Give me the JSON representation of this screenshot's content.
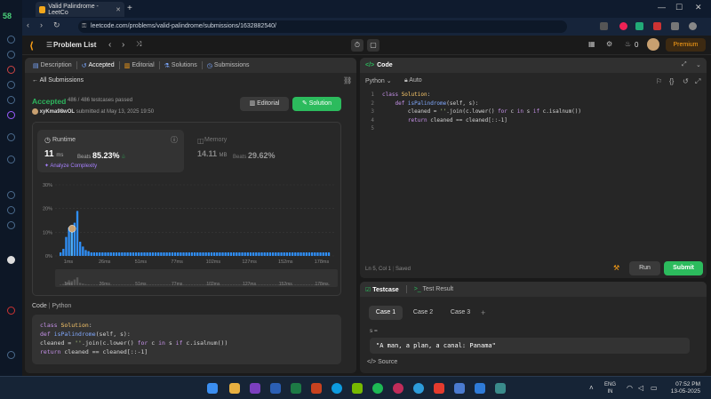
{
  "browser": {
    "tab_title": "Valid Palindrome - LeetCo",
    "url": "leetcode.com/problems/valid-palindrome/submissions/1632882540/",
    "sidebar_number": "58"
  },
  "header": {
    "problem_list": "Problem List",
    "streak": "0",
    "premium": "Premium"
  },
  "left": {
    "tabs": [
      "Description",
      "Accepted",
      "Editorial",
      "Solutions",
      "Submissions"
    ],
    "all_submissions": "All Submissions",
    "status": "Accepted",
    "testcases": "486 / 486 testcases passed",
    "user": "xyKma98wOL",
    "submitted_at": "submitted at May 13, 2025 19:50",
    "editorial_btn": "Editorial",
    "solution_btn": "Solution",
    "runtime": {
      "label": "Runtime",
      "value": "11",
      "unit": "ms",
      "beats_label": "Beats",
      "beats": "85.23%",
      "analyze": "Analyze Complexity"
    },
    "memory": {
      "label": "Memory",
      "value": "14.11",
      "unit": "MB",
      "beats_label": "Beats",
      "beats": "29.62%"
    },
    "code_label": "Code",
    "code_lang": "Python",
    "code_lines": [
      "class Solution:",
      "    def isPalindrome(self, s):",
      "        cleaned = ''.join(c.lower() for c in s if c.isalnum())",
      "        return cleaned == cleaned[::-1]"
    ]
  },
  "chart_data": {
    "type": "bar",
    "y_ticks": [
      "30%",
      "20%",
      "10%",
      "0%"
    ],
    "ylim": [
      0,
      30
    ],
    "x_ticks": [
      "1ms",
      "26ms",
      "51ms",
      "77ms",
      "102ms",
      "127ms",
      "152ms",
      "178ms"
    ],
    "values": [
      1.5,
      3,
      8,
      12,
      10,
      14,
      19,
      6,
      4,
      2.5,
      2,
      1.5,
      1.5,
      1.5,
      1.5,
      1.5,
      1.5,
      1.5,
      1.5,
      1.5,
      1.5,
      1.5,
      1.5,
      1.5,
      1.5,
      1.5,
      1.5,
      1.5,
      1.5,
      1.5,
      1.5,
      1.5,
      1.5,
      1.5,
      1.5,
      1.5,
      1.5,
      1.5,
      1.5,
      1.5,
      1.5,
      1.5,
      1.5,
      1.5,
      1.5,
      1.5,
      1.5,
      1.5,
      1.5,
      1.5,
      1.5,
      1.5,
      1.5,
      1.5,
      1.5,
      1.5,
      1.5,
      1.5,
      1.5,
      1.5,
      1.5,
      1.5,
      1.5,
      1.5,
      1.5,
      1.5,
      1.5,
      1.5,
      1.5,
      1.5,
      1.5,
      1.5,
      1.5,
      1.5,
      1.5,
      1.5,
      1.5,
      1.5,
      1.5,
      1.5,
      1.5,
      1.5,
      1.5,
      1.5,
      1.5,
      1.5,
      1.5,
      1.5,
      1.5,
      1.5,
      1.5,
      1.5,
      1.5,
      1.5,
      1.5,
      1.5,
      1.5
    ],
    "highlight_index": 4,
    "bar_color": "#2f8ef5",
    "highlight_color": "#4bb0ff"
  },
  "right": {
    "code_title": "Code",
    "language": "Python",
    "mode": "Auto",
    "lines": [
      "class Solution:",
      "    def isPalindrome(self, s):",
      "        cleaned = ''.join(c.lower() for c in s if c.isalnum())",
      "        return cleaned == cleaned[::-1]",
      ""
    ],
    "cursor": "Ln 5, Col 1",
    "saved": "Saved",
    "run": "Run",
    "submit": "Submit",
    "testcase_tab": "Testcase",
    "result_tab": "Test Result",
    "cases": [
      "Case 1",
      "Case 2",
      "Case 3"
    ],
    "var_name": "s =",
    "var_value": "\"A man, a plan, a canal: Panama\"",
    "source": "Source"
  },
  "taskbar": {
    "lang1": "ENG",
    "lang2": "IN",
    "time": "07:52 PM",
    "date": "13-05-2025"
  }
}
